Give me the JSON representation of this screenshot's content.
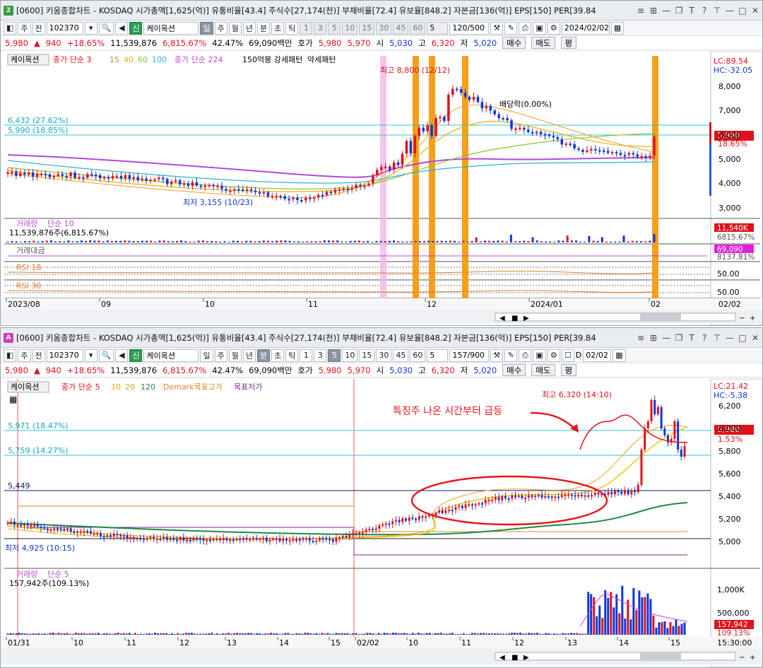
{
  "top": {
    "win_num": "2",
    "title": "[0600] 키움종합차트 - KOSDAQ 시가총액[1,625(억)] 유통비율[43.4] 주식수[27,174(천)] 부채비율[72.4] 유보율[848.2] 자본금[136(억)] EPS[150] PER[39.84",
    "toolbar": {
      "btn_ju": "주",
      "btn_jeon": "전",
      "code": "102370",
      "name": "케이옥션",
      "periods": [
        "일",
        "주",
        "월",
        "년",
        "분",
        "초",
        "틱"
      ],
      "selected_period": "일",
      "nums": [
        "1",
        "3",
        "5",
        "10",
        "15",
        "30",
        "45",
        "60"
      ],
      "combo": "5",
      "count": "120/500",
      "date": "2024/02/02"
    },
    "quote": {
      "price": "5,980",
      "arrow": "▲",
      "change": "940",
      "pct": "+18.65%",
      "volume": "11,539,876",
      "vol_pct": "6,815.67%",
      "turnover": "42.47%",
      "amount": "69,090백만",
      "hoga_label": "호가",
      "ask": "5,980",
      "bid": "5,970",
      "open_label": "시",
      "open": "5,030",
      "high_label": "고",
      "high": "6,320",
      "low_label": "저",
      "low": "5,020",
      "buy": "매수",
      "sell": "매도",
      "pyeong": "평"
    },
    "legend": {
      "name": "케이옥션",
      "l1": "종가 단순 3",
      "l2": "15",
      "l3": "40",
      "l4": "60",
      "l5": "100",
      "l6": "종가 단순 224",
      "l7": "150억봉 강세패턴",
      "l8": "약세패턴"
    },
    "lc": "LC:89.54",
    "hc": "HC:-32.05",
    "annotations": {
      "high": "최고 8,800 (12/12)",
      "low": "최저 3,155 (10/23)",
      "baedang": "배당락(0.00%)",
      "h1": "6,432 (27.62%)",
      "h2": "5,990 (18.85%)"
    },
    "price_tag": "5,980",
    "price_tag_pct": "18.65%",
    "yaxis": [
      "8,000",
      "7,000",
      "6,000",
      "5,000",
      "4,000",
      "3,000"
    ],
    "volume_panel": {
      "label": "거래량",
      "label2": "단순 10",
      "value": "11,539,876주(6,815.67%)",
      "tag": "11,540K",
      "tag2": "6815.67%"
    },
    "amount_panel": {
      "label": "거래대금",
      "tag": "69,090",
      "tag2": "8137.81%"
    },
    "rsi18": {
      "label": "RSI 18",
      "axis": "50.00"
    },
    "rsi30": {
      "label": "RSI 30",
      "axis": "50.00"
    },
    "xaxis": [
      "2023/08",
      "09",
      "10",
      "11",
      "12",
      "2024/01",
      "02"
    ],
    "xaxis_right": "02/02"
  },
  "bottom": {
    "win_num": "A",
    "title": "[0600] 키움종합차트 - KOSDAQ 시가총액[1,625(억)] 유통비율[43.4] 주식수[27,174(천)] 부채비율[72.4] 유보율[848.2] 자본금[136(억)] EPS[150] PER[39.84",
    "toolbar": {
      "btn_ju": "주",
      "btn_jeon": "전",
      "code": "102370",
      "name": "케이옥션",
      "periods": [
        "일",
        "주",
        "월",
        "년",
        "분",
        "초",
        "틱"
      ],
      "selected_period": "분",
      "nums": [
        "1",
        "3",
        "5",
        "10",
        "15",
        "30",
        "45",
        "60"
      ],
      "selected_num": "5",
      "combo": "5",
      "count": "157/900",
      "dlabel": "D",
      "date": "02/02"
    },
    "quote": {
      "price": "5,980",
      "arrow": "▲",
      "change": "940",
      "pct": "+18.65%",
      "volume": "11,539,876",
      "vol_pct": "6,815.67%",
      "turnover": "42.47%",
      "amount": "69,090백만",
      "hoga_label": "호가",
      "ask": "5,980",
      "bid": "5,970",
      "open_label": "시",
      "open": "5,030",
      "high_label": "고",
      "high": "6,320",
      "low_label": "저",
      "low": "5,020",
      "buy": "매수",
      "sell": "매도",
      "pyeong": "평"
    },
    "legend": {
      "name": "케이옥션",
      "l1": "종가 단순 5",
      "l2": "10",
      "l3": "20",
      "l4": "120",
      "l5": "Demark목표고가",
      "l6": "목표저가"
    },
    "lc": "LC:21.42",
    "hc": "HC:-5.38",
    "annotations": {
      "high": "최고 6,320 (14:10)",
      "low": "최저 4,925 (10:15)",
      "note": "특징주 나온 시간부터 급등",
      "h1": "5,971 (18.47%)",
      "h2": "5,759 (14.27%)",
      "h3": "5,449"
    },
    "price_tag": "5,980",
    "price_tag_pct": "1.53%",
    "yaxis": [
      "6,200",
      "6,000",
      "5,800",
      "5,600",
      "5,400",
      "5,200",
      "5,000"
    ],
    "volume_panel": {
      "label": "거래량",
      "label2": "단순 5",
      "value": "157,942주(109.13%)",
      "tag": "157,942",
      "tag2": "109.13%",
      "axis": [
        "1,000K",
        "500,000"
      ]
    },
    "xaxis": [
      "01/31",
      "10",
      "11",
      "12",
      "13",
      "14",
      "15",
      "02/02",
      "10",
      "11",
      "12",
      "13",
      "14",
      "15"
    ],
    "xaxis_right": "15:30:00"
  }
}
